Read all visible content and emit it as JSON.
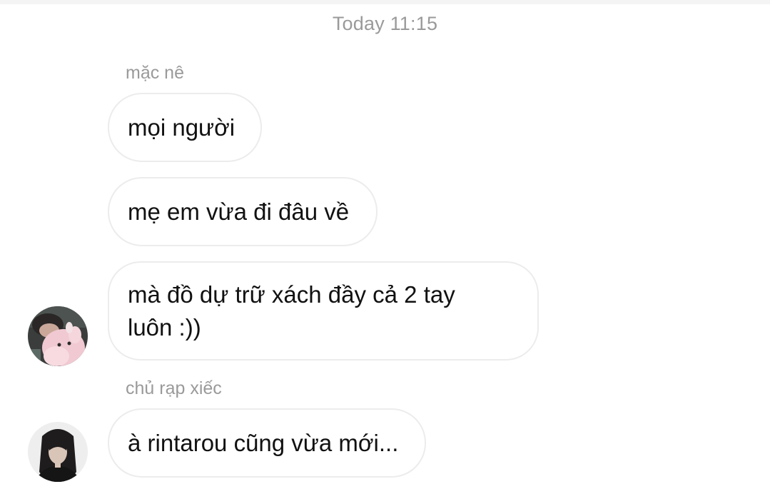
{
  "chat": {
    "timestamp": "Today 11:15",
    "groups": [
      {
        "sender": "mặc nê",
        "avatar_icon": "user-avatar-plush-toy",
        "messages": [
          "mọi người",
          "mẹ em vừa đi đâu về",
          "mà đồ dự trữ xách đầy cả 2 tay luôn :))"
        ]
      },
      {
        "sender": "chủ rạp xiếc",
        "avatar_icon": "user-avatar-long-hair",
        "messages": [
          "à rintarou cũng vừa mới..."
        ]
      }
    ]
  },
  "colors": {
    "background": "#ffffff",
    "bubble_border": "#ececec",
    "meta_text": "#9a9a9a",
    "message_text": "#111111"
  }
}
